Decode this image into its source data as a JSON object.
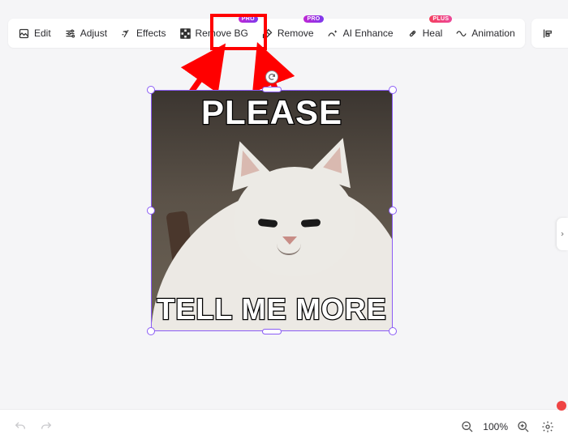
{
  "toolbar": {
    "edit": {
      "label": "Edit"
    },
    "adjust": {
      "label": "Adjust"
    },
    "effects": {
      "label": "Effects"
    },
    "remove_bg": {
      "label": "Remove BG",
      "badge": "PRO"
    },
    "remove": {
      "label": "Remove",
      "badge": "PRO"
    },
    "ai_enhance": {
      "label": "AI Enhance"
    },
    "heal": {
      "label": "Heal",
      "badge": "PLUS"
    },
    "animation": {
      "label": "Animation"
    }
  },
  "badges": {
    "pro": "PRO",
    "plus": "PLUS"
  },
  "canvas": {
    "meme_top": "PLEASE",
    "meme_bottom": "TELL ME MORE"
  },
  "bottom": {
    "zoom": "100%"
  },
  "annotation": {
    "highlight_target": "remove-button"
  }
}
